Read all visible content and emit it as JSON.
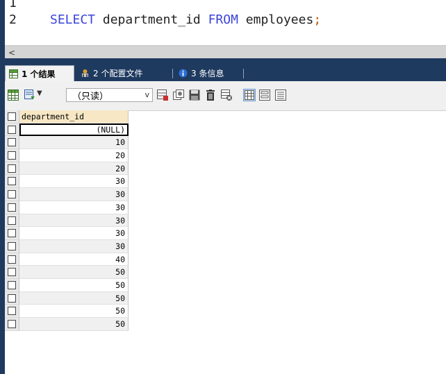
{
  "editor": {
    "line_numbers": [
      "1",
      "2"
    ],
    "sql": {
      "select": "SELECT",
      "column": " department_id ",
      "from": "FROM",
      "table": " employees",
      "semicolon": ";"
    }
  },
  "scrollbar": {
    "left_arrow": "<"
  },
  "tabs": [
    {
      "label": "1 个结果",
      "icon": "grid-icon"
    },
    {
      "label": "2 个配置文件",
      "icon": "profile-icon"
    },
    {
      "label": "3 条信息",
      "icon": "info-icon"
    }
  ],
  "toolbar": {
    "readonly_value": "（只读）",
    "dropdown_arrow": "v"
  },
  "grid": {
    "column_header": "department_id",
    "rows": [
      "(NULL)",
      "10",
      "20",
      "20",
      "30",
      "30",
      "30",
      "30",
      "30",
      "30",
      "40",
      "50",
      "50",
      "50",
      "50",
      "50"
    ]
  },
  "colors": {
    "dark_frame": "#1f3a5f",
    "keyword": "#3b44d8",
    "header_bg": "#f7e7c4"
  }
}
